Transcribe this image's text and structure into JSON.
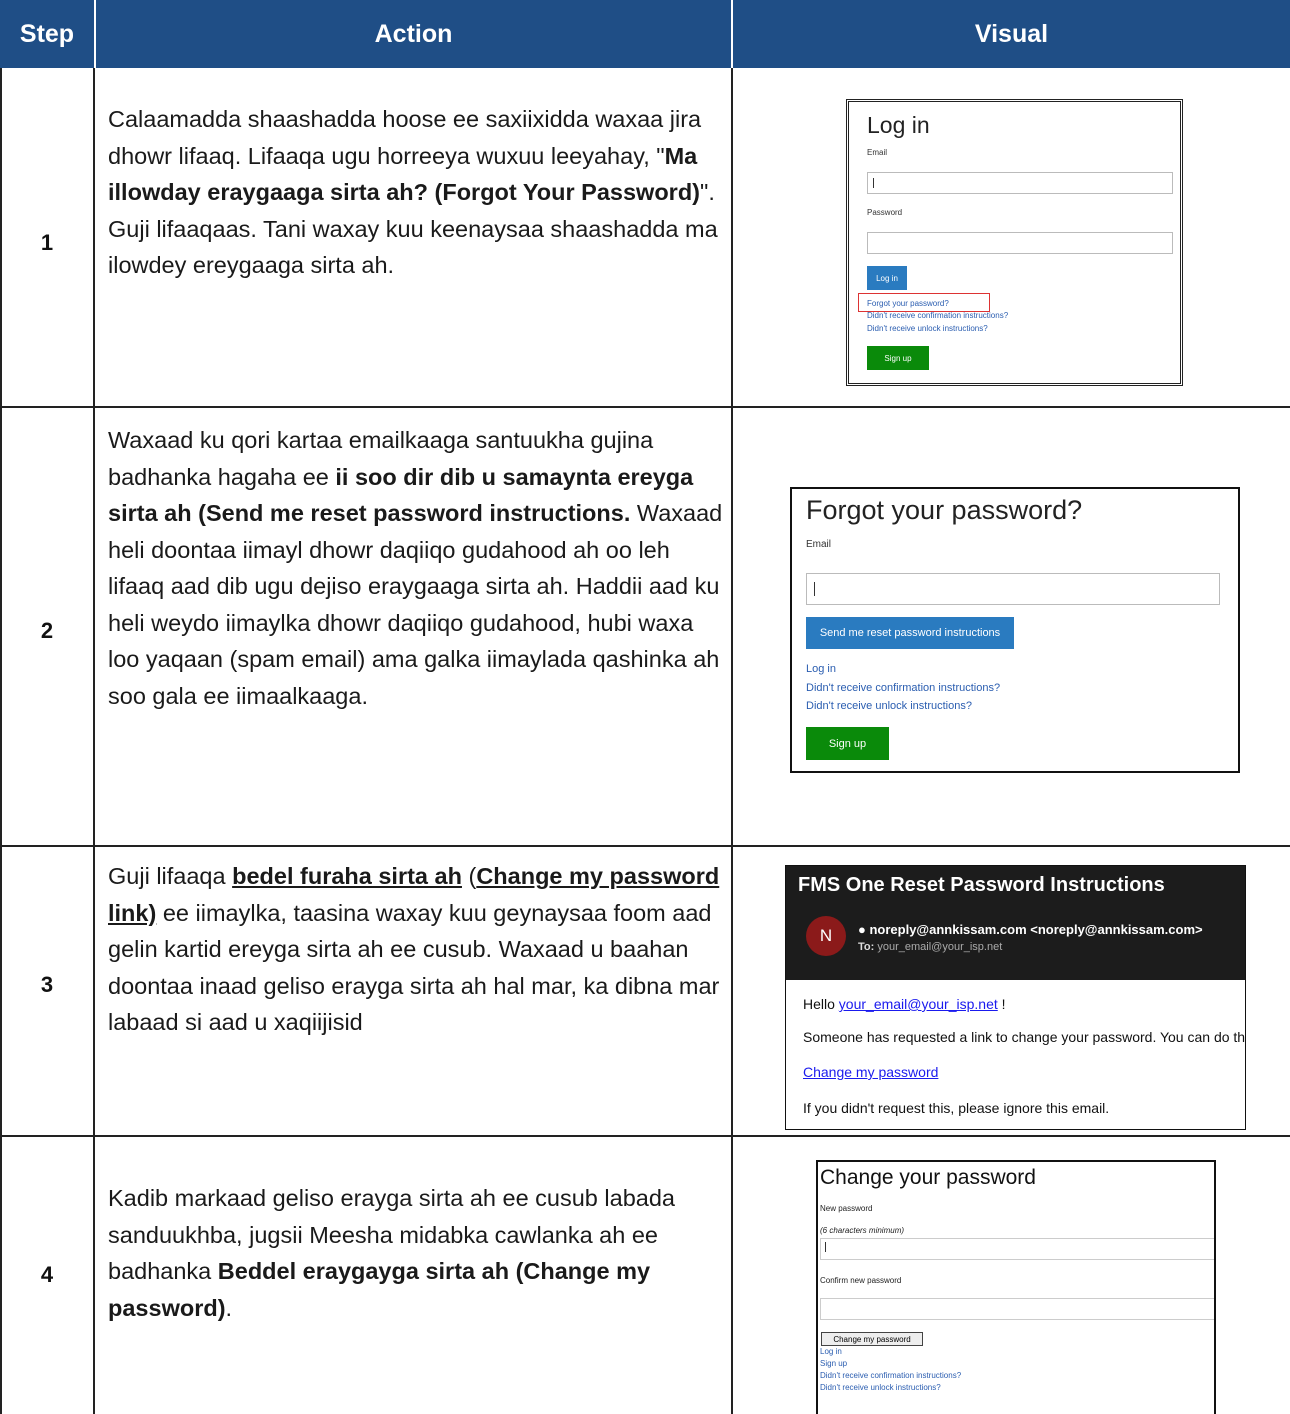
{
  "table": {
    "headers": {
      "step": "Step",
      "action": "Action",
      "visual": "Visual"
    }
  },
  "rows": [
    {
      "step": "1",
      "t1": "Calaamadda shaashadda hoose ee saxiixidda waxaa jira dhowr lifaaq. Lifaaqa ugu horreeya wuxuu leeyahay, \"",
      "b1": "Ma illowday eraygaaga sirta ah? (Forgot Your Password)",
      "t2": "\". Guji lifaaqaas. Tani waxay kuu keenaysaa shaashadda ma ilowdey ereygaaga sirta ah."
    },
    {
      "step": "2",
      "t1": "Waxaad ku qori kartaa emailkaaga santuukha gujina badhanka hagaha ee ",
      "b1": "ii soo dir dib u samaynta ereyga sirta ah (Send me reset password instructions.",
      "t2": " Waxaad heli doontaa iimayl dhowr daqiiqo gudahood ah oo leh lifaaq aad dib ugu dejiso eraygaaga sirta ah. Haddii aad ku heli weydo iimaylka dhowr daqiiqo gudahood, hubi waxa loo yaqaan (spam email) ama galka iimaylada qashinka ah soo gala ee iimaalkaaga."
    },
    {
      "step": "3",
      "t1": "Guji lifaaqa ",
      "bu1": "bedel furaha sirta ah",
      "t2": " (",
      "bu2": "Change my password link)",
      "t3": " ee iimaylka, taasina waxay kuu geynaysaa foom aad gelin kartid ereyga sirta ah ee cusub. Waxaad u baahan doontaa inaad geliso erayga sirta ah hal mar, ka dibna mar labaad si aad u xaqiijisid"
    },
    {
      "step": "4",
      "t1": "Kadib markaad geliso erayga sirta ah ee cusub labada sanduukhba, jugsii Meesha midabka cawlanka ah ee badhanka ",
      "b1": "Beddel eraygayga sirta ah (Change my password)",
      "t2": "."
    }
  ],
  "shot1": {
    "title": "Log in",
    "email_label": "Email",
    "password_label": "Password",
    "login_button": "Log in",
    "forgot_link": "Forgot your password?",
    "confirm_link": "Didn't receive confirmation instructions?",
    "unlock_link": "Didn't receive unlock instructions?",
    "signup_button": "Sign up"
  },
  "shot2": {
    "title": "Forgot your password?",
    "email_label": "Email",
    "send_button": "Send me reset password instructions",
    "login_link": "Log in",
    "confirm_link": "Didn't receive confirmation instructions?",
    "unlock_link": "Didn't receive unlock instructions?",
    "signup_button": "Sign up"
  },
  "shot3": {
    "subject": "FMS One Reset Password Instructions",
    "avatar_letter": "N",
    "from": "noreply@annkissam.com <noreply@annkissam.com>",
    "to_label": "To:",
    "to_value": "your_email@your_isp.net",
    "hello": "Hello ",
    "hello_link": "your_email@your_isp.net",
    "hello_end": " !",
    "body1": "Someone has requested a link to change your password. You can do this through the link below.",
    "change_link": "Change my password",
    "body2": "If you didn't request this, please ignore this email."
  },
  "shot4": {
    "title": "Change your password",
    "new_label": "New password",
    "hint": "(6 characters minimum)",
    "confirm_label": "Confirm new password",
    "change_button": "Change my password",
    "login_link": "Log in",
    "signup_link": "Sign up",
    "confirm_link": "Didn't receive confirmation instructions?",
    "unlock_link": "Didn't receive unlock instructions?"
  },
  "colors": {
    "header_bg": "#1f4e86",
    "blue_button": "#2a7bc0",
    "green_button": "#0a8a0a",
    "avatar": "#8b1a1a"
  }
}
